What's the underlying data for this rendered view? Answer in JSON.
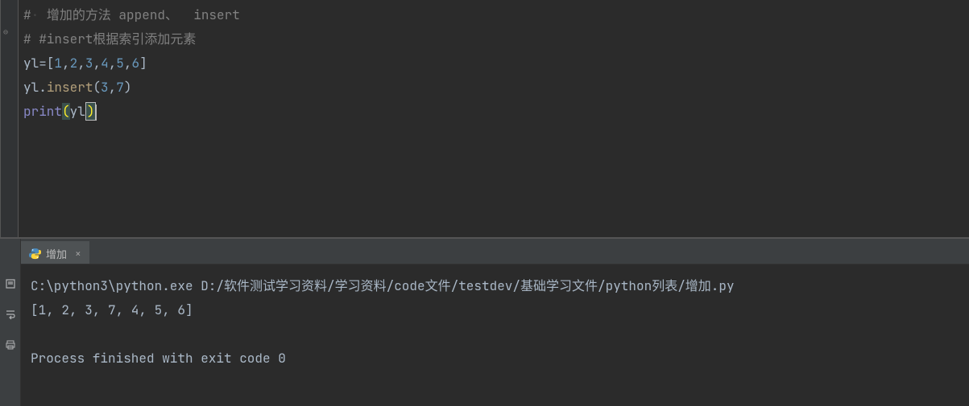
{
  "code": {
    "line1": {
      "hash": "#",
      "text1": " 增加的方法 ",
      "kw1": "append",
      "sep": "、  ",
      "kw2": "insert"
    },
    "line2": {
      "hash": "#",
      "text": " #insert根据索引添加元素"
    },
    "line3": {
      "var": "yl",
      "eq": "=",
      "lb": "[",
      "n1": "1",
      "c1": ",",
      "n2": "2",
      "c2": ",",
      "n3": "3",
      "c3": ",",
      "n4": "4",
      "c4": ",",
      "n5": "5",
      "c5": ",",
      "n6": "6",
      "rb": "]"
    },
    "line4": {
      "var": "yl",
      "dot": ".",
      "method": "insert",
      "lp": "(",
      "a1": "3",
      "comma": ",",
      "a2": "7",
      "rp": ")"
    },
    "line5": {
      "fn": "print",
      "lp": "(",
      "arg": "yl",
      "rp": ")"
    }
  },
  "console": {
    "tab_name": "增加",
    "line1": "C:\\python3\\python.exe D:/软件测试学习资料/学习资料/code文件/testdev/基础学习文件/python列表/增加.py",
    "line2": "[1, 2, 3, 7, 4, 5, 6]",
    "line3": "",
    "line4": "Process finished with exit code 0"
  }
}
